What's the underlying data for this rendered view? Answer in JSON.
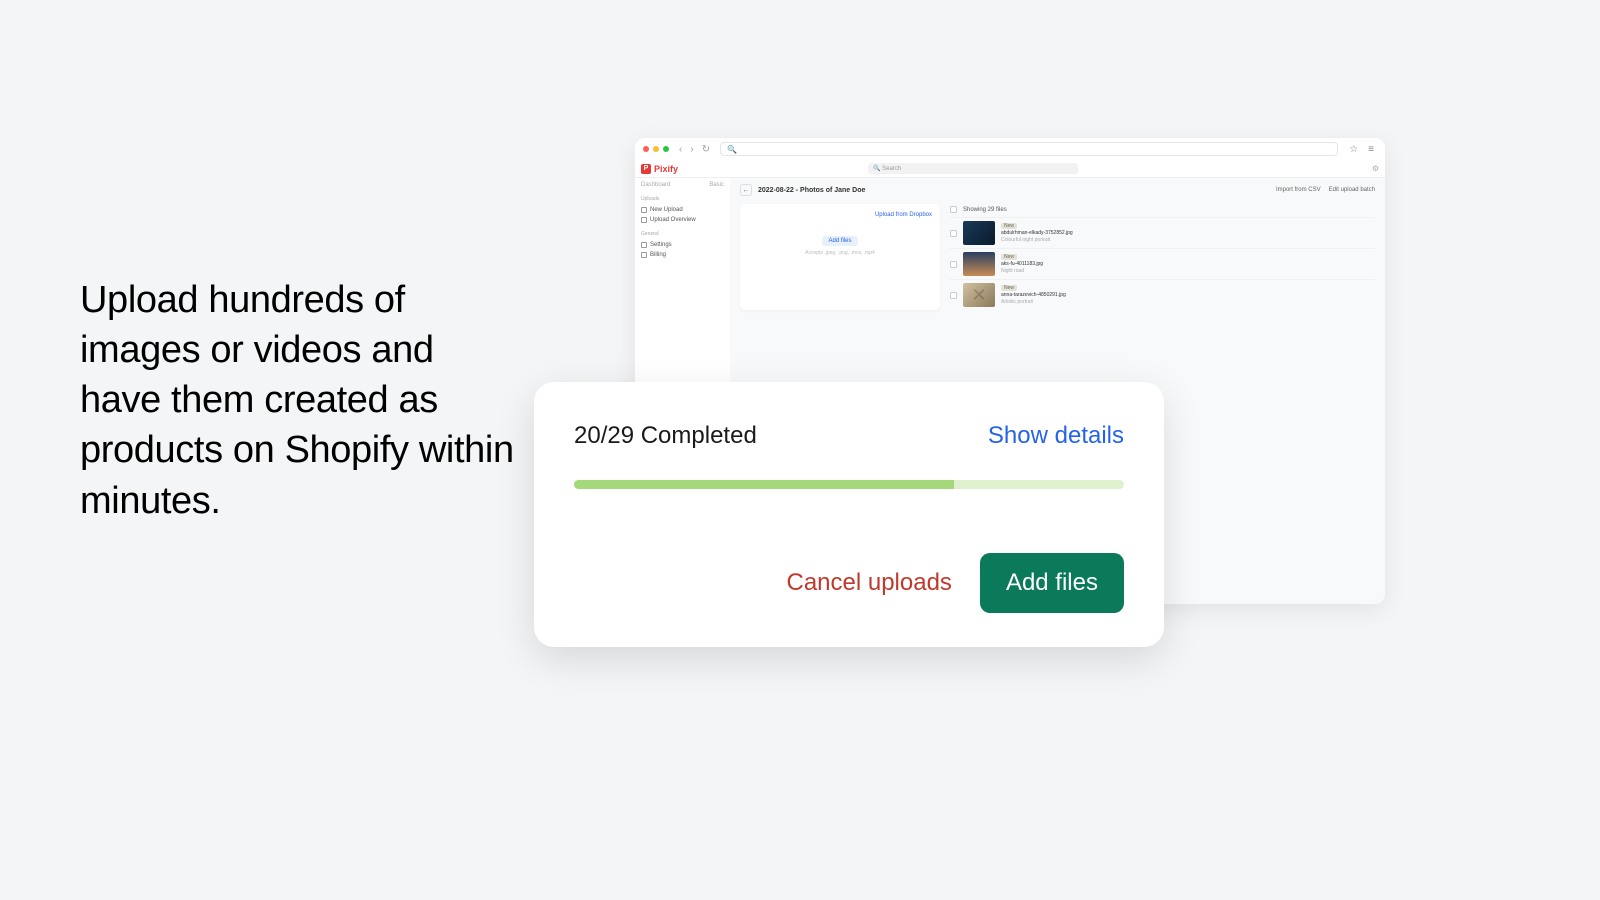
{
  "marketing": {
    "headline": "Upload hundreds of images or videos and have them created as products on Shopify within minutes."
  },
  "browser": {
    "star": "☆",
    "menu": "≡"
  },
  "app": {
    "brand": "Pixify",
    "search_placeholder": "Search",
    "settings_dot": "⚙"
  },
  "sidebar": {
    "dashboard": "Dashboard",
    "basic": "Basic",
    "section_uploads": "Uploads",
    "new_upload": "New Upload",
    "upload_overview": "Upload Overview",
    "section_general": "General",
    "settings": "Settings",
    "billing": "Billing"
  },
  "main": {
    "back_arrow": "←",
    "title": "2022-08-22 - Photos of Jane Doe",
    "import_csv": "Import from CSV",
    "edit_batch": "Edit upload batch",
    "upload_from_dropbox": "Upload from Dropbox",
    "add_files": "Add files",
    "accepts": "Accepts .jpeg, .png, .mov, .mp4",
    "showing": "Showing 29 files",
    "files": [
      {
        "badge": "New",
        "name": "abdulrhman-elkady-3752852.jpg",
        "desc": "Colourful night portrait"
      },
      {
        "badge": "New",
        "name": "aks-fu-4011183.jpg",
        "desc": "Night road"
      },
      {
        "badge": "New",
        "name": "anna-tarazevich-4850291.jpg",
        "desc": "Artistic portrait"
      }
    ]
  },
  "progress": {
    "status": "20/29 Completed",
    "show_details": "Show details",
    "percent": 69,
    "cancel": "Cancel uploads",
    "add_files": "Add files"
  }
}
